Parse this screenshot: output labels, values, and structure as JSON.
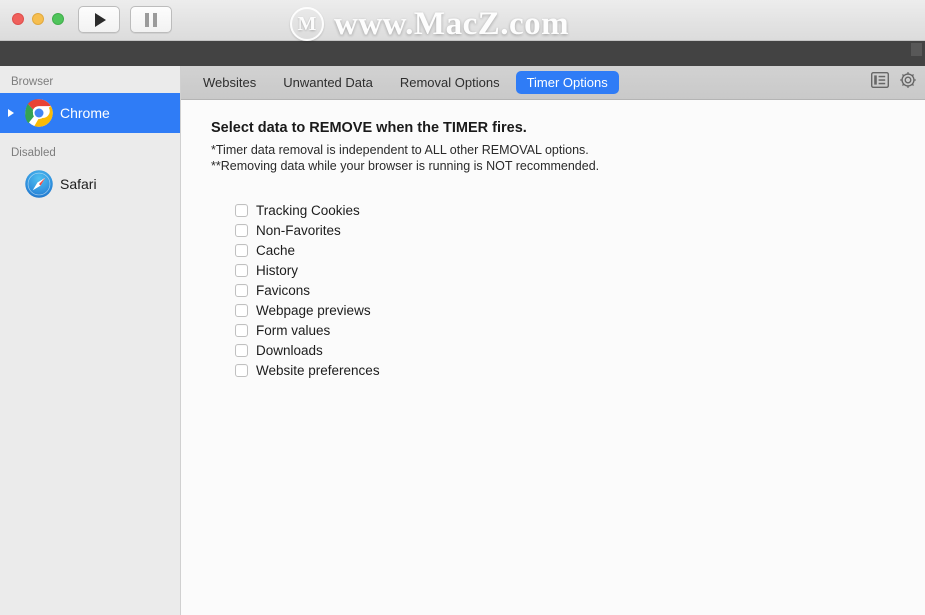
{
  "window": {
    "traffic_lights": [
      {
        "name": "close",
        "color": "#f0605c"
      },
      {
        "name": "minimize",
        "color": "#f6be4f"
      },
      {
        "name": "maximize",
        "color": "#4fc45b"
      }
    ],
    "transport": {
      "play_icon": "play-icon",
      "pause_icon": "pause-icon"
    }
  },
  "watermark": {
    "logo_letter": "M",
    "text": "www.MacZ.com"
  },
  "toolbar": {
    "tabs": [
      {
        "label": "Websites",
        "active": false
      },
      {
        "label": "Unwanted Data",
        "active": false
      },
      {
        "label": "Removal Options",
        "active": false
      },
      {
        "label": "Timer Options",
        "active": true
      }
    ],
    "active_tab_color": "#2f7cf6",
    "icons": [
      {
        "name": "list-view-icon"
      },
      {
        "name": "gear-icon"
      }
    ]
  },
  "sidebar": {
    "sections": [
      {
        "header": "Browser",
        "items": [
          {
            "label": "Chrome",
            "icon": "chrome-icon",
            "selected": true,
            "disclosure": true
          }
        ]
      },
      {
        "header": "Disabled",
        "items": [
          {
            "label": "Safari",
            "icon": "safari-icon",
            "selected": false,
            "disclosure": false
          }
        ]
      }
    ],
    "selection_color": "#2f7cf6"
  },
  "main": {
    "title": "Select data to REMOVE when the TIMER fires.",
    "note_1": "*Timer data removal is independent to ALL other REMOVAL options.",
    "note_2": "**Removing data while your browser is running is NOT recommended.",
    "options": [
      {
        "label": "Tracking Cookies",
        "checked": false
      },
      {
        "label": "Non-Favorites",
        "checked": false
      },
      {
        "label": "Cache",
        "checked": false
      },
      {
        "label": "History",
        "checked": false
      },
      {
        "label": "Favicons",
        "checked": false
      },
      {
        "label": "Webpage previews",
        "checked": false
      },
      {
        "label": "Form values",
        "checked": false
      },
      {
        "label": "Downloads",
        "checked": false
      },
      {
        "label": "Website preferences",
        "checked": false
      }
    ]
  }
}
